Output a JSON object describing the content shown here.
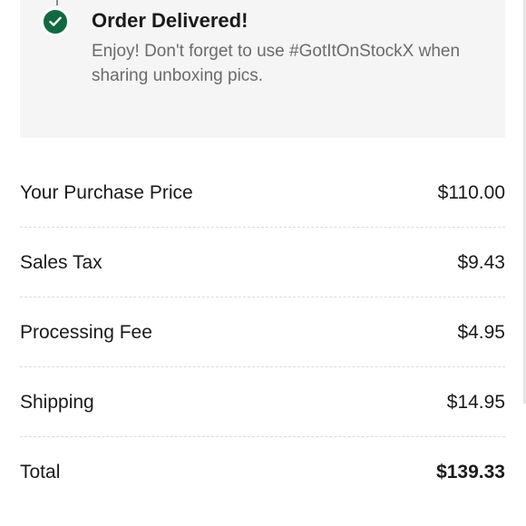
{
  "status": {
    "icon": "check-circle-icon",
    "accent_color": "#0f6a3f",
    "title": "Order Delivered!",
    "message": "Enjoy! Don't forget to use #GotItOnStockX when sharing unboxing pics."
  },
  "summary": {
    "rows": [
      {
        "label": "Your Purchase Price",
        "value": "$110.00"
      },
      {
        "label": "Sales Tax",
        "value": "$9.43"
      },
      {
        "label": "Processing Fee",
        "value": "$4.95"
      },
      {
        "label": "Shipping",
        "value": "$14.95"
      },
      {
        "label": "Total",
        "value": "$139.33"
      }
    ]
  }
}
